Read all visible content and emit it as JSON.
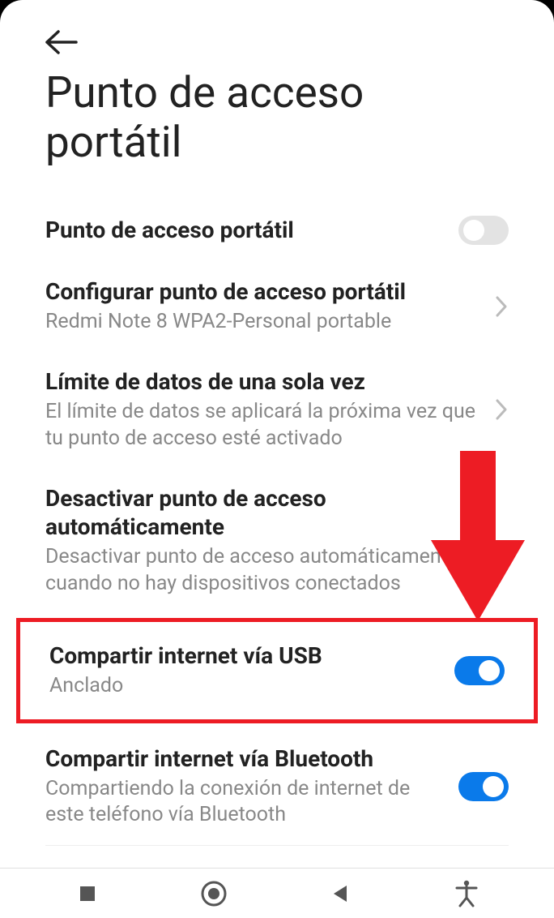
{
  "header": {
    "title": "Punto de acceso portátil"
  },
  "settings": {
    "hotspot": {
      "title": "Punto de acceso portátil",
      "enabled": false
    },
    "configure": {
      "title": "Configurar punto de acceso portátil",
      "subtitle": "Redmi Note 8 WPA2-Personal portable"
    },
    "data_limit": {
      "title": "Límite de datos de una sola vez",
      "subtitle": "El límite de datos se aplicará la próxima vez que tu punto de acceso esté activado"
    },
    "auto_off": {
      "title": "Desactivar punto de acceso automáticamente",
      "subtitle": "Desactivar punto de acceso automáticamente cuando no hay dispositivos conectados",
      "enabled": true
    },
    "usb_tether": {
      "title": "Compartir internet vía USB",
      "subtitle": "Anclado",
      "enabled": true
    },
    "bt_tether": {
      "title": "Compartir internet vía Bluetooth",
      "subtitle": "Compartiendo la conexión de internet de este teléfono vía Bluetooth",
      "enabled": true
    }
  },
  "annotation": {
    "highlight_target": "usb_tether",
    "arrow_color": "#ED1C24"
  }
}
